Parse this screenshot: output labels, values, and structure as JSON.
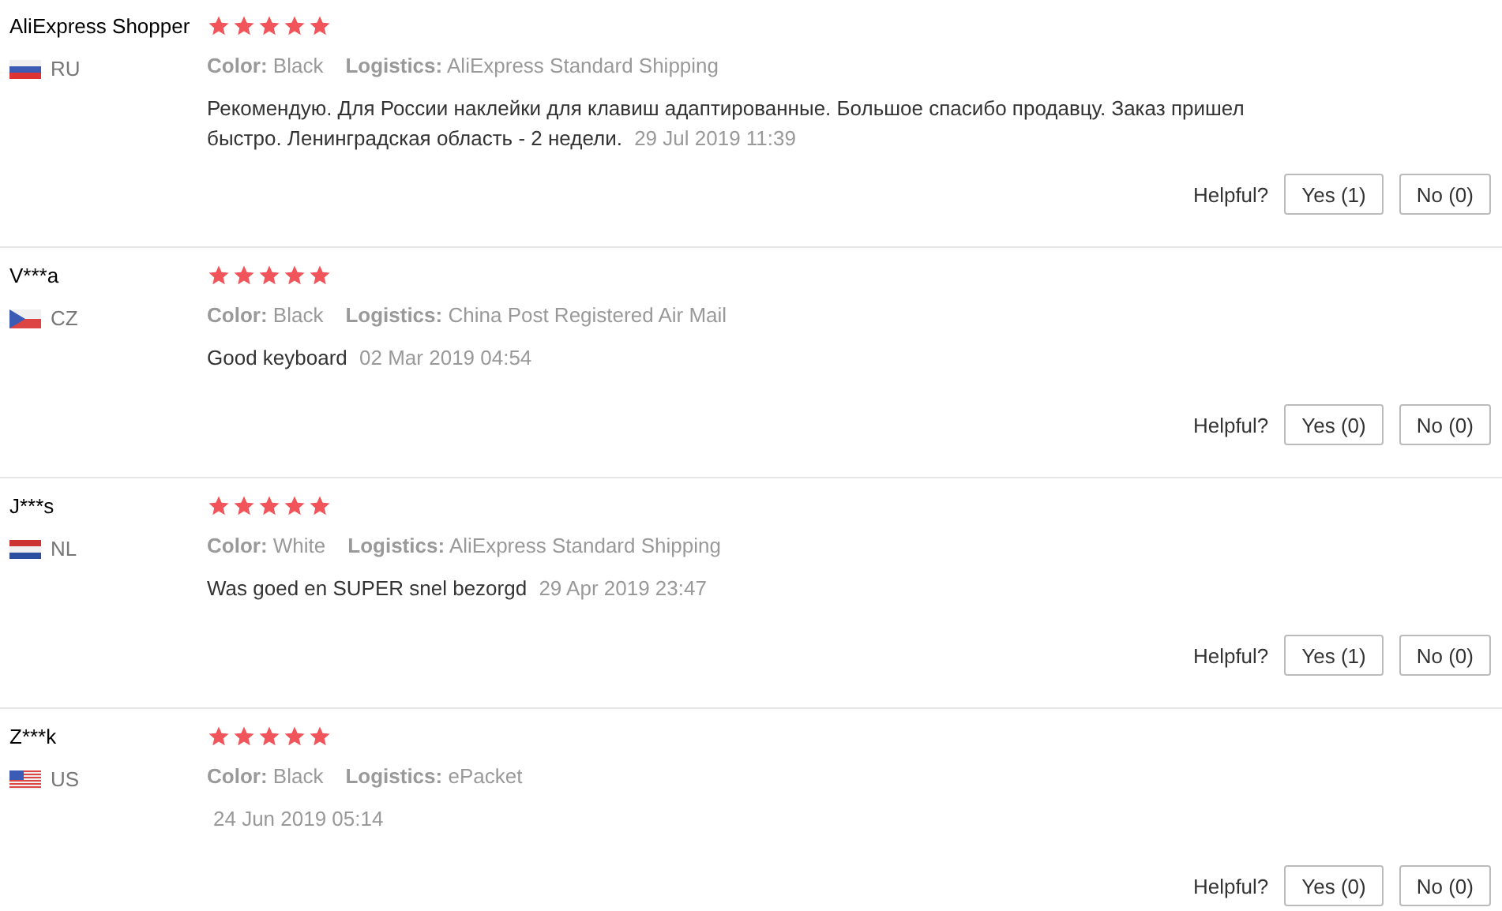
{
  "reviews": [
    {
      "name": "AliExpress Shopper",
      "kind": "ru",
      "country": "RU",
      "stars": 5,
      "color_label": "Color:",
      "color_value": "Black",
      "logistics_label": "Logistics:",
      "logistics": "AliExpress Standard Shipping",
      "text": "Рекомендую. Для России наклейки для клавиш адаптированные. Большое спасибо продавцу. Заказ пришел быстро. Ленинградская область - 2 недели.",
      "date": "29 Jul 2019 11:39",
      "helpful": "Helpful?",
      "yes": "Yes (1)",
      "no": "No (0)"
    },
    {
      "name": "V***a",
      "kind": "cz",
      "country": "CZ",
      "stars": 5,
      "color_label": "Color:",
      "color_value": "Black",
      "logistics_label": "Logistics:",
      "logistics": "China Post Registered Air Mail",
      "text": "Good keyboard",
      "date": "02 Mar 2019 04:54",
      "helpful": "Helpful?",
      "yes": "Yes (0)",
      "no": "No (0)"
    },
    {
      "name": "J***s",
      "kind": "nl",
      "country": "NL",
      "stars": 5,
      "color_label": "Color:",
      "color_value": "White",
      "logistics_label": "Logistics:",
      "logistics": "AliExpress Standard Shipping",
      "text": "Was goed en SUPER snel bezorgd",
      "date": "29 Apr 2019 23:47",
      "helpful": "Helpful?",
      "yes": "Yes (1)",
      "no": "No (0)"
    },
    {
      "name": "Z***k",
      "kind": "us",
      "country": "US",
      "stars": 5,
      "color_label": "Color:",
      "color_value": "Black",
      "logistics_label": "Logistics:",
      "logistics": "ePacket",
      "date": "24 Jun 2019 05:14",
      "helpful": "Helpful?",
      "yes": "Yes (0)",
      "no": "No (0)"
    }
  ]
}
